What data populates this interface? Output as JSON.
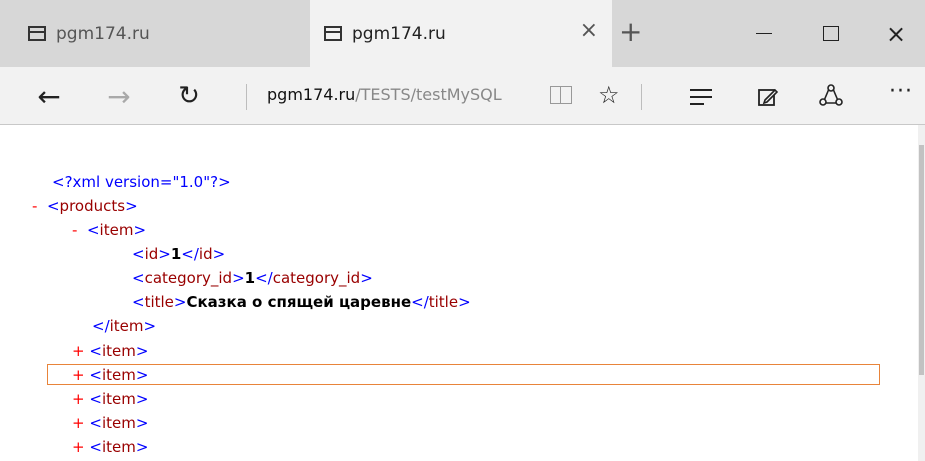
{
  "tabs": [
    {
      "title": "pgm174.ru",
      "active": false
    },
    {
      "title": "pgm174.ru",
      "active": true
    }
  ],
  "tab_close_glyph": "×",
  "new_tab_glyph": "+",
  "window": {
    "close_glyph": "×"
  },
  "nav": {
    "back_glyph": "←",
    "forward_glyph": "→",
    "refresh_glyph": "↻",
    "address_host": "pgm174.ru",
    "address_path": "/TESTS/testMySQL",
    "favorite_glyph": "☆",
    "more_glyph": "···"
  },
  "icons": [
    "tab-page-icon",
    "reading-view-icon",
    "favorite-star-icon",
    "hub-icon",
    "web-note-icon",
    "share-icon",
    "more-icon"
  ],
  "xml": {
    "declaration": "<?xml version=\"1.0\"?>",
    "collapse_marker": "-",
    "expand_marker": "+",
    "open_bracket": "<",
    "close_bracket": ">",
    "end_open_bracket": "</",
    "root_tag": "products",
    "item_tag": "item",
    "fields": [
      {
        "tag": "id",
        "value": "1"
      },
      {
        "tag": "category_id",
        "value": "1"
      },
      {
        "tag": "title",
        "value": "Сказка о спящей царевне"
      }
    ],
    "collapsed_items_count_label": "+ <item>"
  },
  "colors": {
    "tag": "#990000",
    "bracket": "#0000ff",
    "marker": "#ff0000",
    "highlight_border": "#e8843a"
  }
}
